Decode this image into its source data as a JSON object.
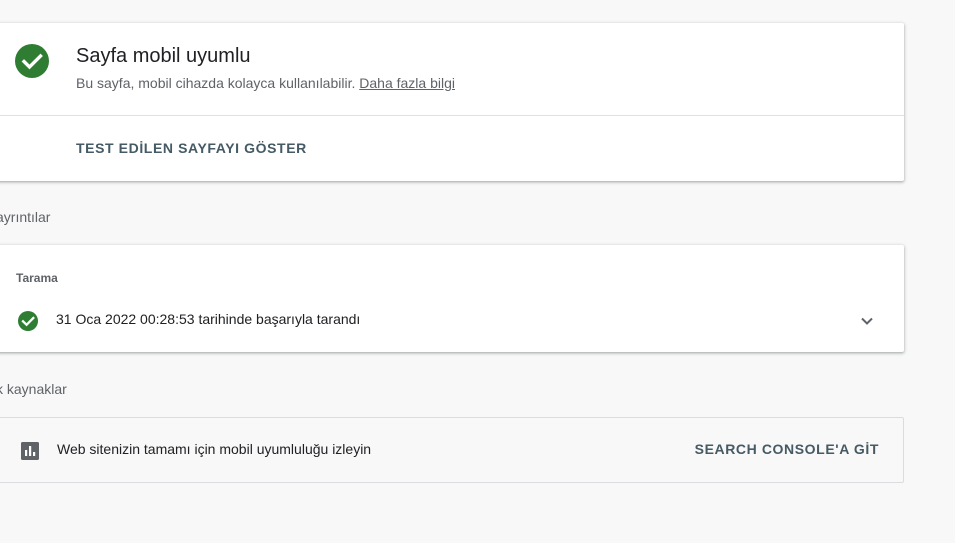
{
  "result": {
    "title": "Sayfa mobil uyumlu",
    "description": "Bu sayfa, mobil cihazda kolayca kullanılabilir.",
    "learn_more": "Daha fazla bilgi",
    "view_tested_page": "TEST EDİLEN SAYFAYI GÖSTER",
    "status_color": "#2e7d32",
    "status_icon": "check-circle-icon"
  },
  "details": {
    "section_label": "ayrıntılar",
    "sub_label": "Tarama",
    "crawl_status": "31 Oca 2022 00:28:53 tarihinde başarıyla tarandı",
    "status_icon": "check-circle-icon",
    "expand_icon": "chevron-down-icon"
  },
  "resources": {
    "section_label": "k kaynaklar",
    "item_text": "Web sitenizin tamamı için mobil uyumluluğu izleyin",
    "item_icon": "bar-chart-icon",
    "action_label": "SEARCH CONSOLE'A GİT"
  }
}
